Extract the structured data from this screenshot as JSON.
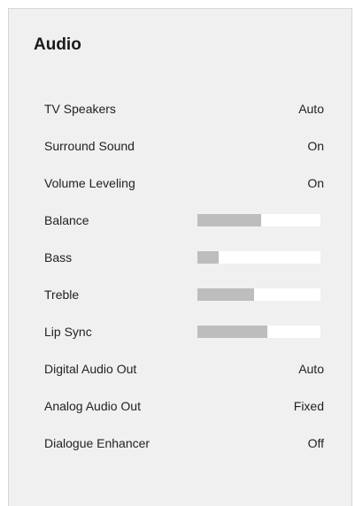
{
  "page": {
    "title": "Audio"
  },
  "menu": {
    "items": [
      {
        "label": "TV Speakers",
        "kind": "value",
        "value": "Auto"
      },
      {
        "label": "Surround Sound",
        "kind": "value",
        "value": "On"
      },
      {
        "label": "Volume Leveling",
        "kind": "value",
        "value": "On"
      },
      {
        "label": "Balance",
        "kind": "slider",
        "level": 0.52
      },
      {
        "label": "Bass",
        "kind": "slider",
        "level": 0.17
      },
      {
        "label": "Treble",
        "kind": "slider",
        "level": 0.46
      },
      {
        "label": "Lip Sync",
        "kind": "slider",
        "level": 0.57
      },
      {
        "label": "Digital Audio Out",
        "kind": "value",
        "value": "Auto"
      },
      {
        "label": "Analog Audio Out",
        "kind": "value",
        "value": "Fixed"
      },
      {
        "label": "Dialogue Enhancer",
        "kind": "value",
        "value": "Off"
      }
    ]
  },
  "colors": {
    "panel_background": "#f0f0f0",
    "slider_track": "#ffffff",
    "slider_fill": "#bdbdbd",
    "text": "#222222"
  }
}
